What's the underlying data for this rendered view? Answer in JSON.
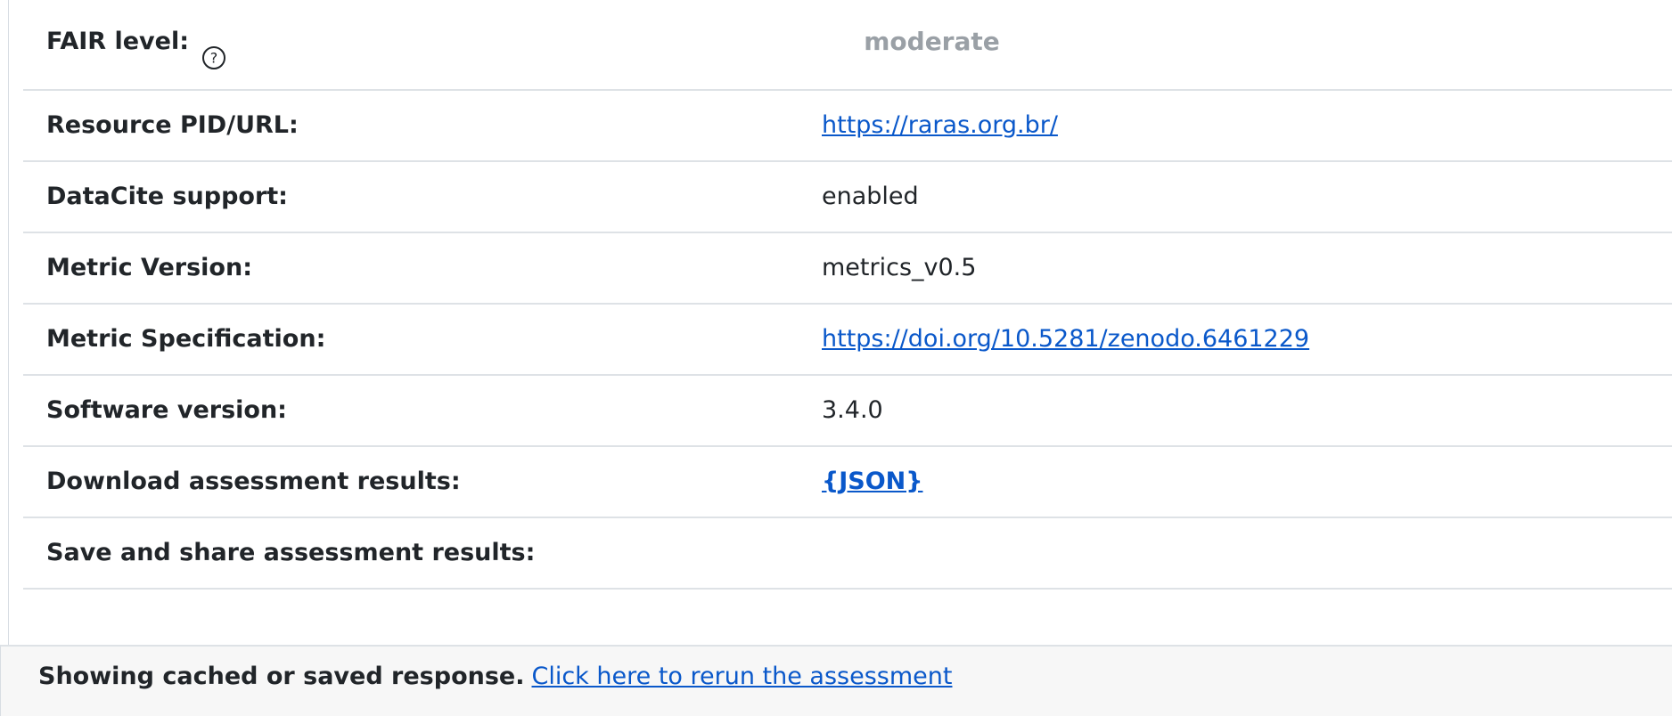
{
  "details": {
    "fair_level": {
      "label": "FAIR level:",
      "value": "moderate"
    },
    "resource_pid": {
      "label": "Resource PID/URL:",
      "value": "https://raras.org.br/"
    },
    "datacite": {
      "label": "DataCite support:",
      "value": "enabled"
    },
    "metric_version": {
      "label": "Metric Version:",
      "value": "metrics_v0.5"
    },
    "metric_spec": {
      "label": "Metric Specification:",
      "value": "https://doi.org/10.5281/zenodo.6461229"
    },
    "software_version": {
      "label": "Software version:",
      "value": "3.4.0"
    },
    "download": {
      "label": "Download assessment results:",
      "value": "{JSON}"
    },
    "save_share": {
      "label": "Save and share assessment results:"
    }
  },
  "footer": {
    "notice": "Showing cached or saved response.",
    "rerun_link": "Click here to rerun the assessment"
  },
  "icons": {
    "help": "question-circle-icon"
  }
}
